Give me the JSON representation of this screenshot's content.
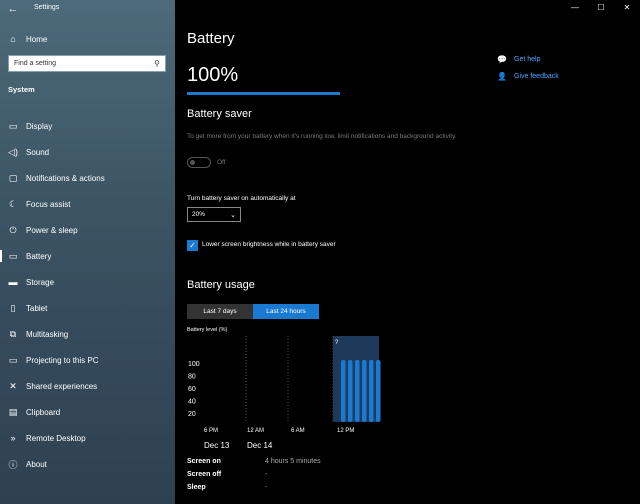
{
  "app": {
    "title": "Settings"
  },
  "window": {
    "minimize": "—",
    "maximize": "☐",
    "close": "✕"
  },
  "sidebar": {
    "home_label": "Home",
    "search_placeholder": "Find a setting",
    "section": "System",
    "items": [
      {
        "label": "Display",
        "icon": "display-icon"
      },
      {
        "label": "Sound",
        "icon": "sound-icon"
      },
      {
        "label": "Notifications & actions",
        "icon": "notifications-icon"
      },
      {
        "label": "Focus assist",
        "icon": "focus-assist-icon"
      },
      {
        "label": "Power & sleep",
        "icon": "power-icon"
      },
      {
        "label": "Battery",
        "icon": "battery-icon",
        "active": true
      },
      {
        "label": "Storage",
        "icon": "storage-icon"
      },
      {
        "label": "Tablet",
        "icon": "tablet-icon"
      },
      {
        "label": "Multitasking",
        "icon": "multitasking-icon"
      },
      {
        "label": "Projecting to this PC",
        "icon": "projecting-icon"
      },
      {
        "label": "Shared experiences",
        "icon": "shared-experiences-icon"
      },
      {
        "label": "Clipboard",
        "icon": "clipboard-icon"
      },
      {
        "label": "Remote Desktop",
        "icon": "remote-desktop-icon"
      },
      {
        "label": "About",
        "icon": "about-icon"
      }
    ]
  },
  "main": {
    "title": "Battery",
    "percent": "100%",
    "percent_value": 100,
    "saver": {
      "heading": "Battery saver",
      "description": "To get more from your battery when it’s running low, limit notifications and background activity.",
      "toggle_state": "Off",
      "auto_label": "Turn battery saver on automatically at",
      "auto_value": "20%",
      "brightness_label": "Lower screen brightness while in battery saver",
      "brightness_checked": true
    },
    "usage": {
      "heading": "Battery usage",
      "tabs": [
        "Last 7 days",
        "Last 24 hours"
      ],
      "active_tab": 1,
      "chart_label": "Battery level (%)",
      "stats": [
        {
          "label": "Screen on",
          "value": "4 hours 5 minutes"
        },
        {
          "label": "Screen off",
          "value": "-"
        },
        {
          "label": "Sleep",
          "value": "-"
        }
      ]
    }
  },
  "help": {
    "get_help": "Get help",
    "give_feedback": "Give feedback"
  },
  "colors": {
    "accent": "#1a7ad1",
    "link": "#4ea5ff"
  },
  "chart_data": {
    "type": "bar",
    "ylabel": "Battery level (%)",
    "yticks": [
      "100",
      "80",
      "60",
      "40",
      "20"
    ],
    "xticks": [
      "6 PM",
      "12 AM",
      "6 AM",
      "12 PM"
    ],
    "dates": [
      "Dec 13",
      "Dec 14"
    ],
    "ylim": [
      0,
      100
    ],
    "series": [
      {
        "values": [
          100,
          100,
          100,
          100,
          100,
          100
        ]
      }
    ]
  }
}
